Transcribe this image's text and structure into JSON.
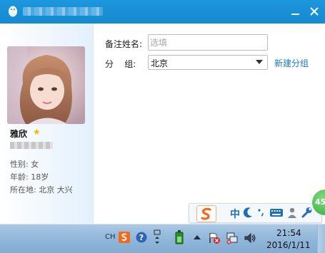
{
  "window": {
    "title_icon": "qq-penguin-icon",
    "min_label": "minimize",
    "close_label": "close"
  },
  "profile": {
    "name": "雅欣",
    "gender": "性别: 女",
    "age": "年龄: 18岁",
    "location": "所在地: 北京  大兴"
  },
  "form": {
    "remark_label": "备注姓名:",
    "remark_placeholder": "选填",
    "group_label": "分    组:",
    "group_value": "北京",
    "new_group_label": "新建分组"
  },
  "ime": {
    "zh_label": "中"
  },
  "badge": {
    "count": "45"
  },
  "taskbar": {
    "ch_label": "CH",
    "time": "21:54",
    "date": "2016/1/11"
  },
  "colors": {
    "title_bar": "#1589cf",
    "link": "#1a78c2",
    "star": "#f5b800",
    "taskbar": "#8fb5d9",
    "ime_s": "#f26a1b",
    "badge": "#2ea83a"
  }
}
